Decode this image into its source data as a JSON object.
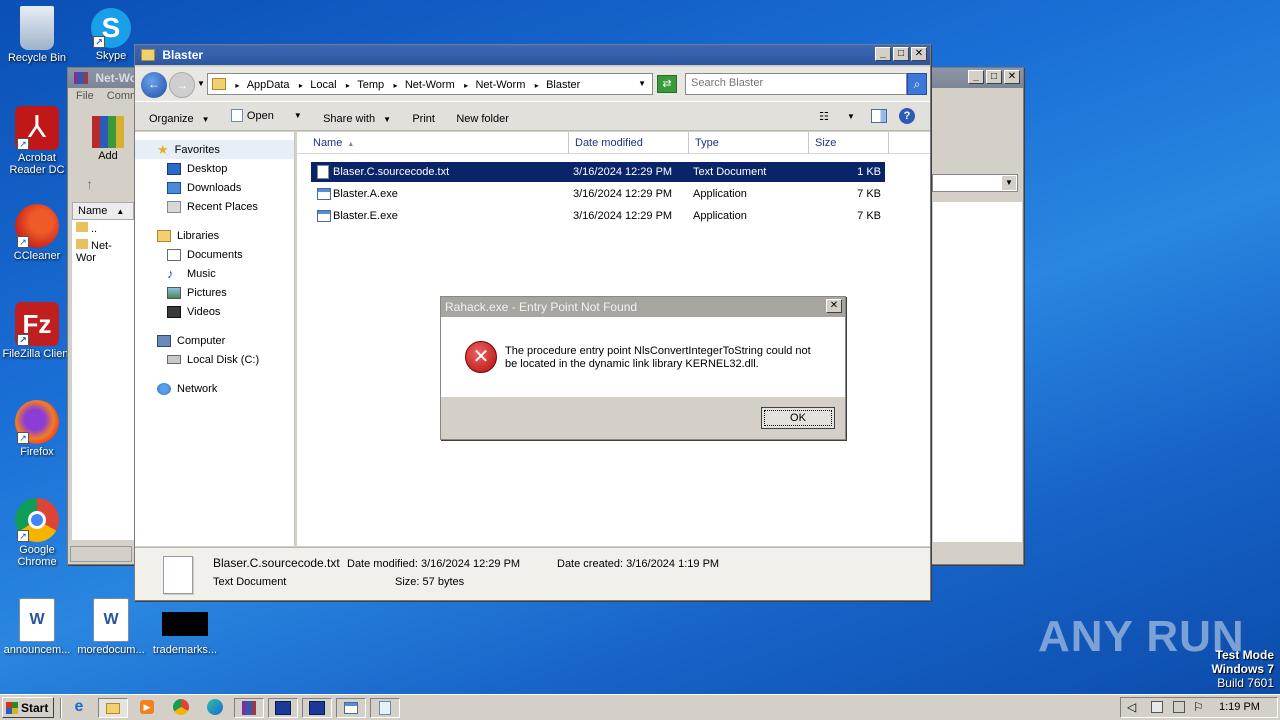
{
  "desktop": {
    "icons": [
      {
        "label": "Recycle Bin"
      },
      {
        "label": "Skype"
      },
      {
        "label": "Acrobat Reader DC"
      },
      {
        "label": "CCleaner"
      },
      {
        "label": "FileZilla Client"
      },
      {
        "label": "Firefox"
      },
      {
        "label": "Google Chrome"
      },
      {
        "label": "announcem..."
      },
      {
        "label": "moredocum..."
      },
      {
        "label": "trademarks..."
      }
    ],
    "watermark": {
      "brand": "ANY RUN",
      "mode": "Test Mode",
      "os": "Windows 7",
      "build": "Build 7601"
    }
  },
  "bg_window": {
    "title": "Net-Wor",
    "menu": [
      "File",
      "Comm"
    ],
    "add_label": "Add",
    "col_name": "Name",
    "rows": [
      "..",
      "Net-Wor"
    ]
  },
  "explorer": {
    "title": "Blaster",
    "breadcrumb": [
      "AppData",
      "Local",
      "Temp",
      "Net-Worm",
      "Net-Worm",
      "Blaster"
    ],
    "search_placeholder": "Search Blaster",
    "toolbar": {
      "organize": "Organize",
      "open": "Open",
      "share": "Share with",
      "print": "Print",
      "new_folder": "New folder"
    },
    "nav": {
      "favorites": "Favorites",
      "desktop": "Desktop",
      "downloads": "Downloads",
      "recent": "Recent Places",
      "libraries": "Libraries",
      "documents": "Documents",
      "music": "Music",
      "pictures": "Pictures",
      "videos": "Videos",
      "computer": "Computer",
      "local_disk": "Local Disk (C:)",
      "network": "Network"
    },
    "columns": {
      "name": "Name",
      "date": "Date modified",
      "type": "Type",
      "size": "Size"
    },
    "files": [
      {
        "name": "Blaser.C.sourcecode.txt",
        "date": "3/16/2024 12:29 PM",
        "type": "Text Document",
        "size": "1 KB"
      },
      {
        "name": "Blaster.A.exe",
        "date": "3/16/2024 12:29 PM",
        "type": "Application",
        "size": "7 KB"
      },
      {
        "name": "Blaster.E.exe",
        "date": "3/16/2024 12:29 PM",
        "type": "Application",
        "size": "7 KB"
      }
    ],
    "details": {
      "filename": "Blaser.C.sourcecode.txt",
      "filetype": "Text Document",
      "modified_label": "Date modified:",
      "modified": "3/16/2024 12:29 PM",
      "size_label": "Size:",
      "size": "57 bytes",
      "created_label": "Date created:",
      "created": "3/16/2024 1:19 PM"
    }
  },
  "dialog": {
    "title": "Rahack.exe - Entry Point Not Found",
    "message_line1": "The procedure entry point NlsConvertIntegerToString could not",
    "message_line2": "be located in the dynamic link library KERNEL32.dll.",
    "ok": "OK"
  },
  "taskbar": {
    "start": "Start",
    "clock": "1:19 PM"
  }
}
